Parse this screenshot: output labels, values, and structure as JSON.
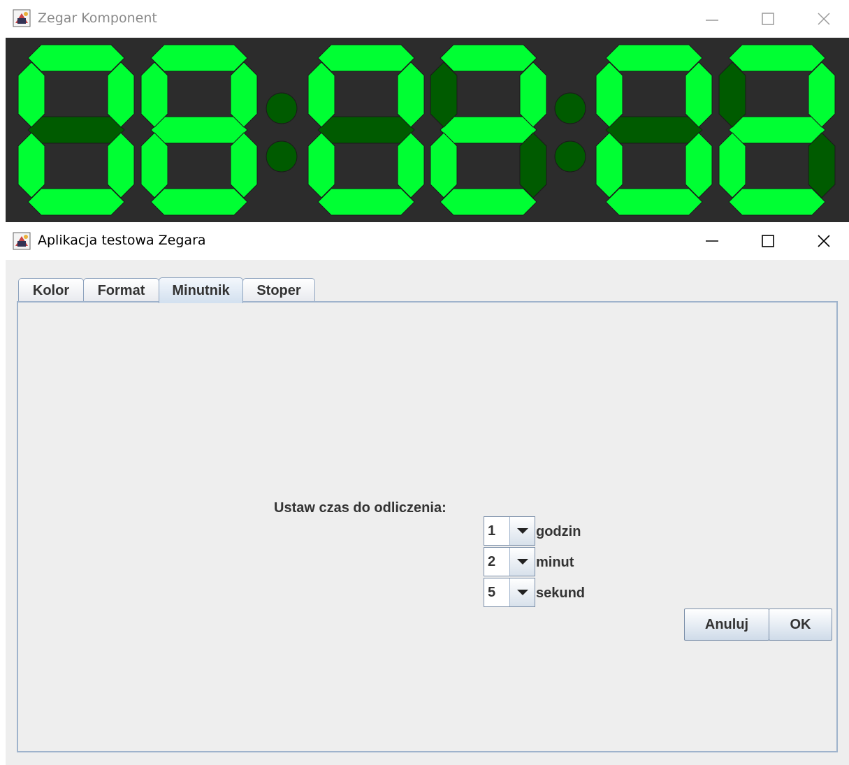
{
  "clock_window": {
    "title": "Zegar Komponent",
    "controls": [
      "minimize-icon",
      "maximize-icon",
      "close-icon"
    ],
    "display": {
      "digits": [
        "0",
        "8",
        "0",
        "2",
        "0",
        "2"
      ],
      "time": "08:02:02",
      "on_color": "#00ff33",
      "off_color": "#005b00",
      "background": "#2c2c2c"
    }
  },
  "app_window": {
    "title": "Aplikacja testowa Zegara",
    "controls": [
      "minimize-icon",
      "maximize-icon",
      "close-icon"
    ],
    "tabs": [
      {
        "label": "Kolor",
        "active": false
      },
      {
        "label": "Format",
        "active": false
      },
      {
        "label": "Minutnik",
        "active": true
      },
      {
        "label": "Stoper",
        "active": false
      }
    ],
    "timer": {
      "prompt": "Ustaw czas do odliczenia:",
      "hours": {
        "value": "1",
        "unit": "godzin"
      },
      "minutes": {
        "value": "2",
        "unit": "minut"
      },
      "seconds": {
        "value": "5",
        "unit": "sekund"
      },
      "cancel_label": "Anuluj",
      "ok_label": "OK"
    }
  }
}
